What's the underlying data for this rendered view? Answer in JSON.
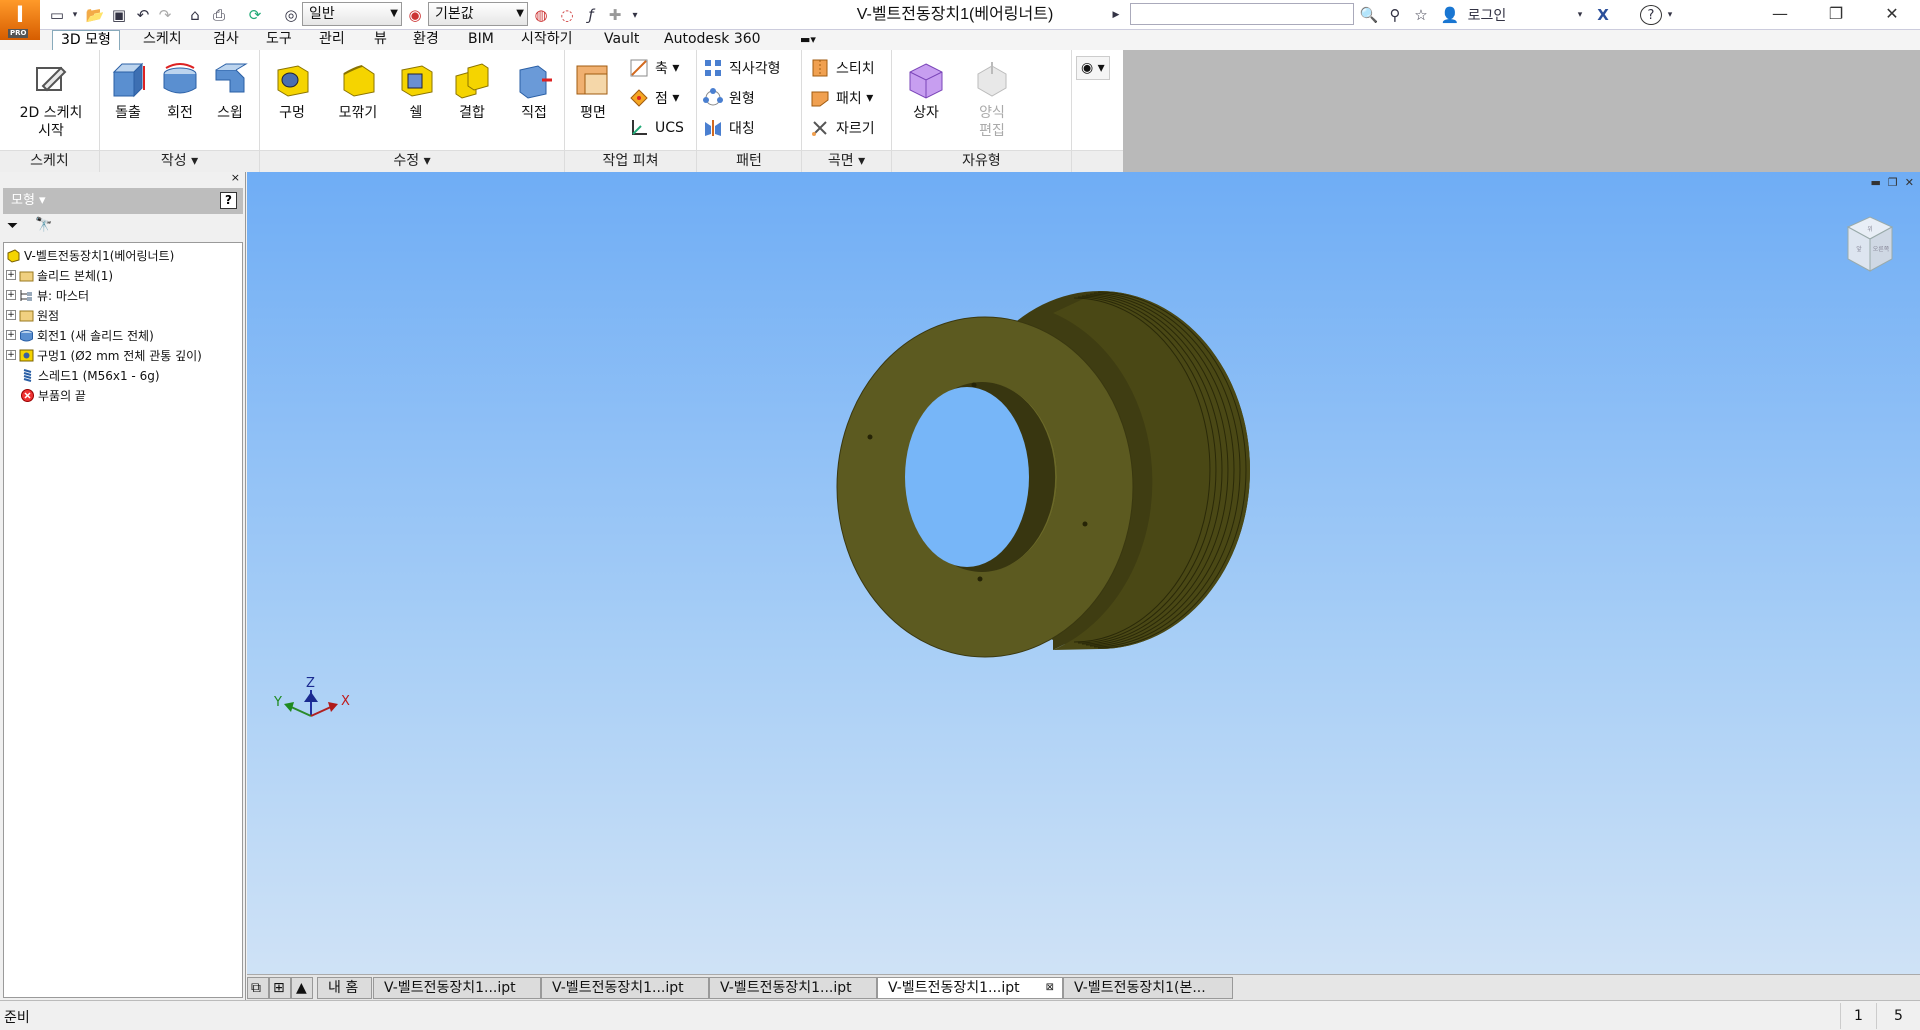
{
  "app": {
    "badge": "I",
    "edition": "PRO"
  },
  "titlebar": {
    "style_combo": "일반",
    "material_combo": "기본값",
    "document_title": "V-벨트전동장치1(베어링너트)",
    "search_placeholder": "",
    "login_label": "로그인",
    "help_label": "?"
  },
  "ribbon_tabs": [
    "3D 모형",
    "스케치",
    "검사",
    "도구",
    "관리",
    "뷰",
    "환경",
    "BIM",
    "시작하기",
    "Vault",
    "Autodesk 360"
  ],
  "ribbon": {
    "sketch": {
      "button": "2D 스케치\n시작",
      "label": "스케치"
    },
    "create": {
      "buttons": [
        "돌출",
        "회전",
        "스윕"
      ],
      "label": "작성"
    },
    "modify": {
      "buttons": [
        "구멍",
        "모깎기",
        "쉘",
        "결합",
        "직접"
      ],
      "label": "수정"
    },
    "work": {
      "plane": "평면",
      "small": [
        "축",
        "점",
        "UCS"
      ],
      "label": "작업 피쳐"
    },
    "pattern": {
      "small": [
        "직사각형",
        "원형",
        "대칭"
      ],
      "label": "패턴"
    },
    "surface": {
      "small": [
        "스티치",
        "패치",
        "자르기"
      ],
      "label": "곡면"
    },
    "freeform": {
      "buttons": [
        "상자",
        "양식\n편집"
      ],
      "label": "자유형"
    }
  },
  "browser": {
    "title": "모형",
    "help": "?",
    "nodes": [
      "V-벨트전동장치1(베어링너트)",
      "솔리드 본체(1)",
      "뷰: 마스터",
      "원점",
      "회전1 (새 솔리드 전체)",
      "구멍1 (Ø2 mm 전체 관통 깊이)",
      "스레드1 (M56x1 - 6g)",
      "부품의 끝"
    ]
  },
  "viewcube": {
    "top": "위",
    "right": "오른쪽",
    "front": "앞"
  },
  "triad": {
    "x": "X",
    "y": "Y",
    "z": "Z"
  },
  "doc_tabs": [
    "내 홈",
    "V-벨트전동장치1...ipt",
    "V-벨트전동장치1...ipt",
    "V-벨트전동장치1...ipt",
    "V-벨트전동장치1...ipt",
    "V-벨트전동장치1(본..."
  ],
  "status": {
    "text": "준비",
    "count1": "1",
    "count2": "5"
  },
  "colors": {
    "part": "#5c5a20",
    "viewport_top": "#6fadf5",
    "viewport_bottom": "#cfe2f6",
    "app_orange": "#e8750b"
  }
}
